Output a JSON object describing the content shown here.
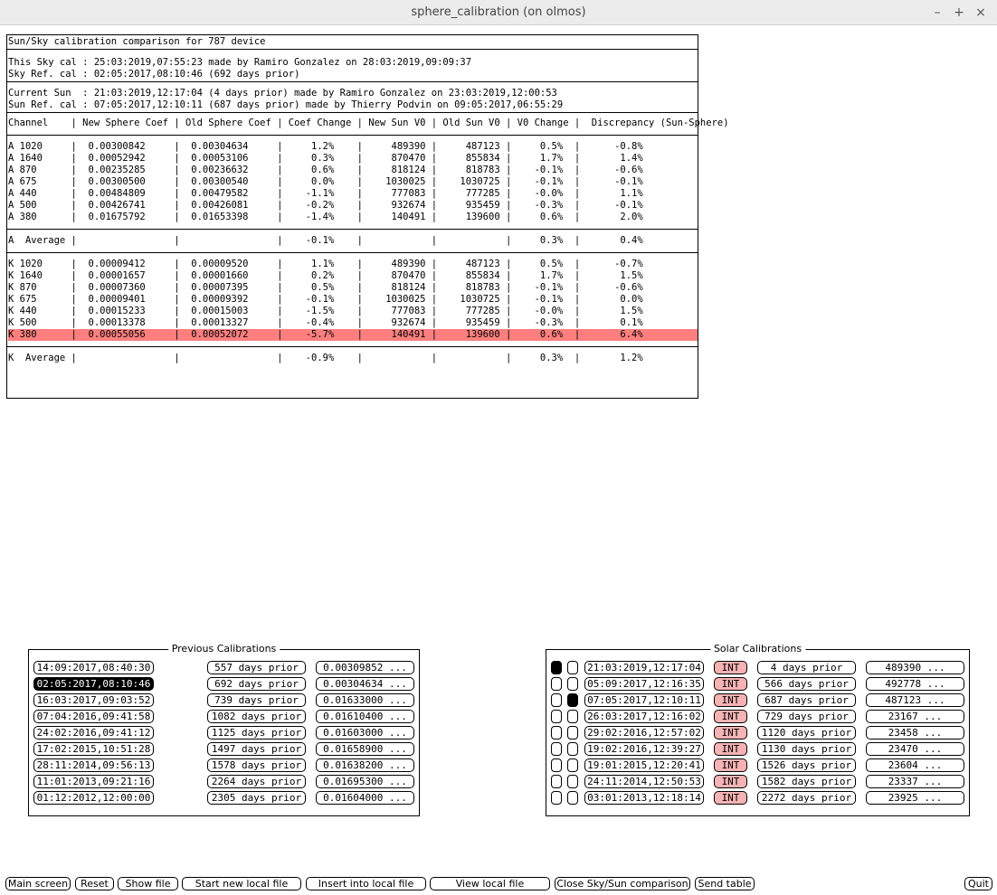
{
  "window": {
    "title": "sphere_calibration (on olmos)",
    "minimize": "–",
    "maximize": "+",
    "close": "×"
  },
  "report": {
    "header": [
      "Sun/Sky calibration comparison for 787 device"
    ],
    "sky": [
      "This Sky cal : 25:03:2019,07:55:23 made by Ramiro Gonzalez on 28:03:2019,09:09:37",
      "Sky Ref. cal : 02:05:2017,08:10:46 (692 days prior)"
    ],
    "sun": [
      "Current Sun  : 21:03:2019,12:17:04 (4 days prior) made by Ramiro Gonzalez on 23:03:2019,12:00:53",
      "Sun Ref. cal : 07:05:2017,12:10:11 (687 days prior) made by Thierry Podvin on 09:05:2017,06:55:29"
    ],
    "columns": [
      "Channel    | New Sphere Coef | Old Sphere Coef | Coef Change | New Sun V0 | Old Sun V0 | V0 Change |  Discrepancy (Sun-Sphere)"
    ],
    "a_rows": [
      "A 1020     |  0.00300842     |  0.00304634     |     1.2%    |     489390 |     487123 |     0.5%  |      -0.8%",
      "A 1640     |  0.00052942     |  0.00053106     |     0.3%    |     870470 |     855834 |     1.7%  |       1.4%",
      "A 870      |  0.00235285     |  0.00236632     |     0.6%    |     818124 |     818783 |    -0.1%  |      -0.6%",
      "A 675      |  0.00300500     |  0.00300540     |     0.0%    |    1030025 |    1030725 |    -0.1%  |      -0.1%",
      "A 440      |  0.00484809     |  0.00479582     |    -1.1%    |     777083 |     777285 |    -0.0%  |       1.1%",
      "A 500      |  0.00426741     |  0.00426081     |    -0.2%    |     932674 |     935459 |    -0.3%  |      -0.1%",
      "A 380      |  0.01675792     |  0.01653398     |    -1.4%    |     140491 |     139600 |     0.6%  |       2.0%"
    ],
    "a_average": [
      "A  Average |                 |                 |    -0.1%    |            |            |     0.3%  |       0.4%"
    ],
    "k_rows": [
      "K 1020     |  0.00009412     |  0.00009520     |     1.1%    |     489390 |     487123 |     0.5%  |      -0.7%",
      "K 1640     |  0.00001657     |  0.00001660     |     0.2%    |     870470 |     855834 |     1.7%  |       1.5%",
      "K 870      |  0.00007360     |  0.00007395     |     0.5%    |     818124 |     818783 |    -0.1%  |      -0.6%",
      "K 675      |  0.00009401     |  0.00009392     |    -0.1%    |    1030025 |    1030725 |    -0.1%  |       0.0%",
      "K 440      |  0.00015233     |  0.00015003     |    -1.5%    |     777083 |     777285 |    -0.0%  |       1.5%",
      "K 500      |  0.00013378     |  0.00013327     |    -0.4%    |     932674 |     935459 |    -0.3%  |       0.1%",
      "K 380      |  0.00055056     |  0.00052072     |    -5.7%    |     140491 |     139600 |     0.6%  |       6.4%"
    ],
    "k_average": [
      "K  Average |                 |                 |    -0.9%    |            |            |     0.3%  |       1.2%"
    ],
    "highlight_color": "#ff7f7f"
  },
  "previous": {
    "title": "Previous Calibrations",
    "selected_index": 1,
    "rows": [
      {
        "date": "14:09:2017,08:40:30",
        "prior": "557 days prior",
        "coef": "0.00309852 ..."
      },
      {
        "date": "02:05:2017,08:10:46",
        "prior": "692 days prior",
        "coef": "0.00304634 ..."
      },
      {
        "date": "16:03:2017,09:03:52",
        "prior": "739 days prior",
        "coef": "0.01633000 ..."
      },
      {
        "date": "07:04:2016,09:41:58",
        "prior": "1082 days prior",
        "coef": "0.01610400 ..."
      },
      {
        "date": "24:02:2016,09:41:12",
        "prior": "1125 days prior",
        "coef": "0.01603000 ..."
      },
      {
        "date": "17:02:2015,10:51:28",
        "prior": "1497 days prior",
        "coef": "0.01658900 ..."
      },
      {
        "date": "28:11:2014,09:56:13",
        "prior": "1578 days prior",
        "coef": "0.01638200 ..."
      },
      {
        "date": "11:01:2013,09:21:16",
        "prior": "2264 days prior",
        "coef": "0.01695300 ..."
      },
      {
        "date": "01:12:2012,12:00:00",
        "prior": "2305 days prior",
        "coef": "0.01604000 ..."
      }
    ]
  },
  "solar": {
    "title": "Solar Calibrations",
    "int_color": "#f6b3b3",
    "rows": [
      {
        "check1": true,
        "check2": false,
        "date": "21:03:2019,12:17:04",
        "type": "INT",
        "prior": "4 days prior",
        "v0": "489390 ..."
      },
      {
        "check1": false,
        "check2": false,
        "date": "05:09:2017,12:16:35",
        "type": "INT",
        "prior": "566 days prior",
        "v0": "492778 ..."
      },
      {
        "check1": false,
        "check2": true,
        "date": "07:05:2017,12:10:11",
        "type": "INT",
        "prior": "687 days prior",
        "v0": "487123 ..."
      },
      {
        "check1": false,
        "check2": false,
        "date": "26:03:2017,12:16:02",
        "type": "INT",
        "prior": "729 days prior",
        "v0": "23167 ..."
      },
      {
        "check1": false,
        "check2": false,
        "date": "29:02:2016,12:57:02",
        "type": "INT",
        "prior": "1120 days prior",
        "v0": "23458 ..."
      },
      {
        "check1": false,
        "check2": false,
        "date": "19:02:2016,12:39:27",
        "type": "INT",
        "prior": "1130 days prior",
        "v0": "23470 ..."
      },
      {
        "check1": false,
        "check2": false,
        "date": "19:01:2015,12:20:41",
        "type": "INT",
        "prior": "1526 days prior",
        "v0": "23604 ..."
      },
      {
        "check1": false,
        "check2": false,
        "date": "24:11:2014,12:50:53",
        "type": "INT",
        "prior": "1582 days prior",
        "v0": "23337 ..."
      },
      {
        "check1": false,
        "check2": false,
        "date": "03:01:2013,12:18:14",
        "type": "INT",
        "prior": "2272 days prior",
        "v0": "23925 ..."
      }
    ]
  },
  "buttons": {
    "main_screen": "Main screen",
    "reset": "Reset",
    "show_file": "Show file",
    "start_new": "Start new local file",
    "insert": "Insert into local file",
    "view_local": "View local file",
    "close_cmp": "Close Sky/Sun comparison",
    "send_table": "Send table",
    "quit": "Quit"
  }
}
